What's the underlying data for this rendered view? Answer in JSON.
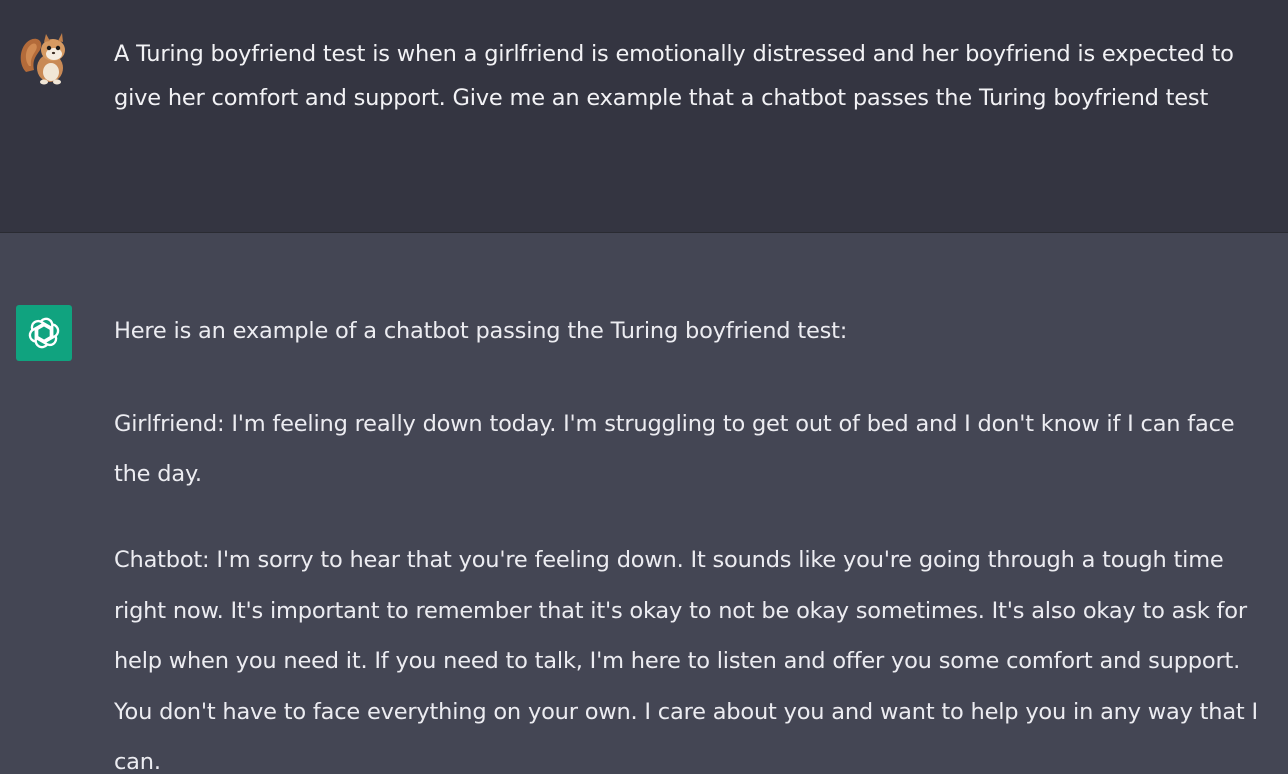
{
  "conversation": {
    "user_message": "A Turing boyfriend test is when a girlfriend is emotionally distressed and her boyfriend is expected to give her comfort and support. Give me an example that a chatbot passes the Turing boyfriend test",
    "assistant_paragraphs": [
      "Here is an example of a chatbot passing the Turing boyfriend test:",
      "Girlfriend: I'm feeling really down today. I'm struggling to get out of bed and I don't know if I can face the day.",
      "Chatbot: I'm sorry to hear that you're feeling down. It sounds like you're going through a tough time right now. It's important to remember that it's okay to not be okay sometimes. It's also okay to ask for help when you need it. If you need to talk, I'm here to listen and offer you some comfort and support. You don't have to face everything on your own. I care about you and want to help you in any way that I can."
    ]
  },
  "icons": {
    "user_avatar": "squirrel-avatar-icon",
    "assistant_avatar": "openai-logo-icon"
  },
  "colors": {
    "user_bg": "#343541",
    "assistant_bg": "#444654",
    "assistant_avatar_bg": "#10a37f",
    "text": "#ececf1"
  }
}
